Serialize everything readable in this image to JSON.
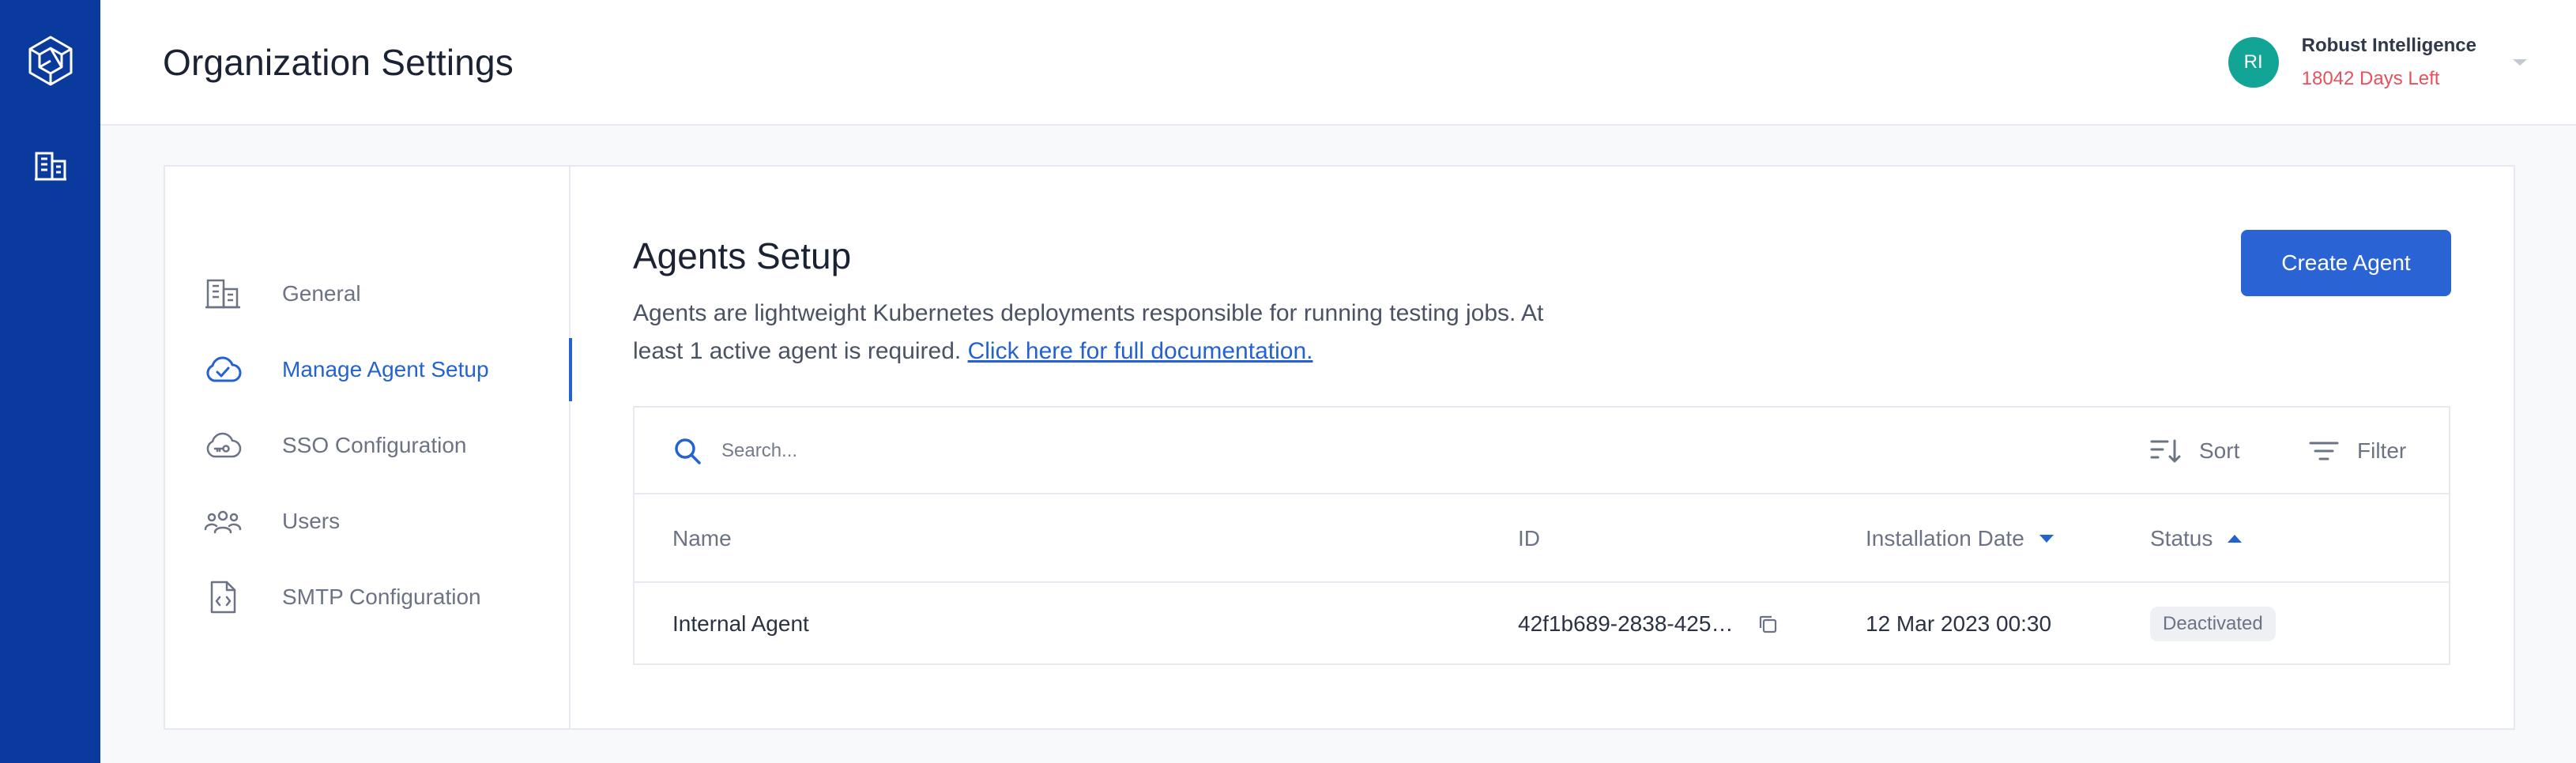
{
  "header": {
    "title": "Organization Settings",
    "account": {
      "initials": "RI",
      "name": "Robust Intelligence",
      "days_left": "18042 Days Left"
    }
  },
  "sidebar": {
    "items": [
      {
        "label": "General",
        "icon": "building-icon"
      },
      {
        "label": "Manage Agent Setup",
        "icon": "cloud-check-icon",
        "active": true
      },
      {
        "label": "SSO Configuration",
        "icon": "cloud-key-icon"
      },
      {
        "label": "Users",
        "icon": "users-icon"
      },
      {
        "label": "SMTP Configuration",
        "icon": "file-code-icon"
      }
    ]
  },
  "main": {
    "title": "Agents Setup",
    "description": "Agents are lightweight Kubernetes deployments responsible for running testing jobs. At least 1 active agent is required.",
    "doc_link": "Click here for full documentation.",
    "create_button": "Create Agent"
  },
  "table": {
    "search_placeholder": "Search...",
    "sort_label": "Sort",
    "filter_label": "Filter",
    "columns": [
      "Name",
      "ID",
      "Installation Date",
      "Status"
    ],
    "rows": [
      {
        "name": "Internal Agent",
        "id": "42f1b689-2838-425…",
        "date": "12 Mar 2023 00:30",
        "status": "Deactivated"
      }
    ]
  },
  "colors": {
    "rail": "#0b3a9e",
    "accent": "#2463cf",
    "avatar": "#12a596",
    "warning_text": "#e8505b"
  }
}
